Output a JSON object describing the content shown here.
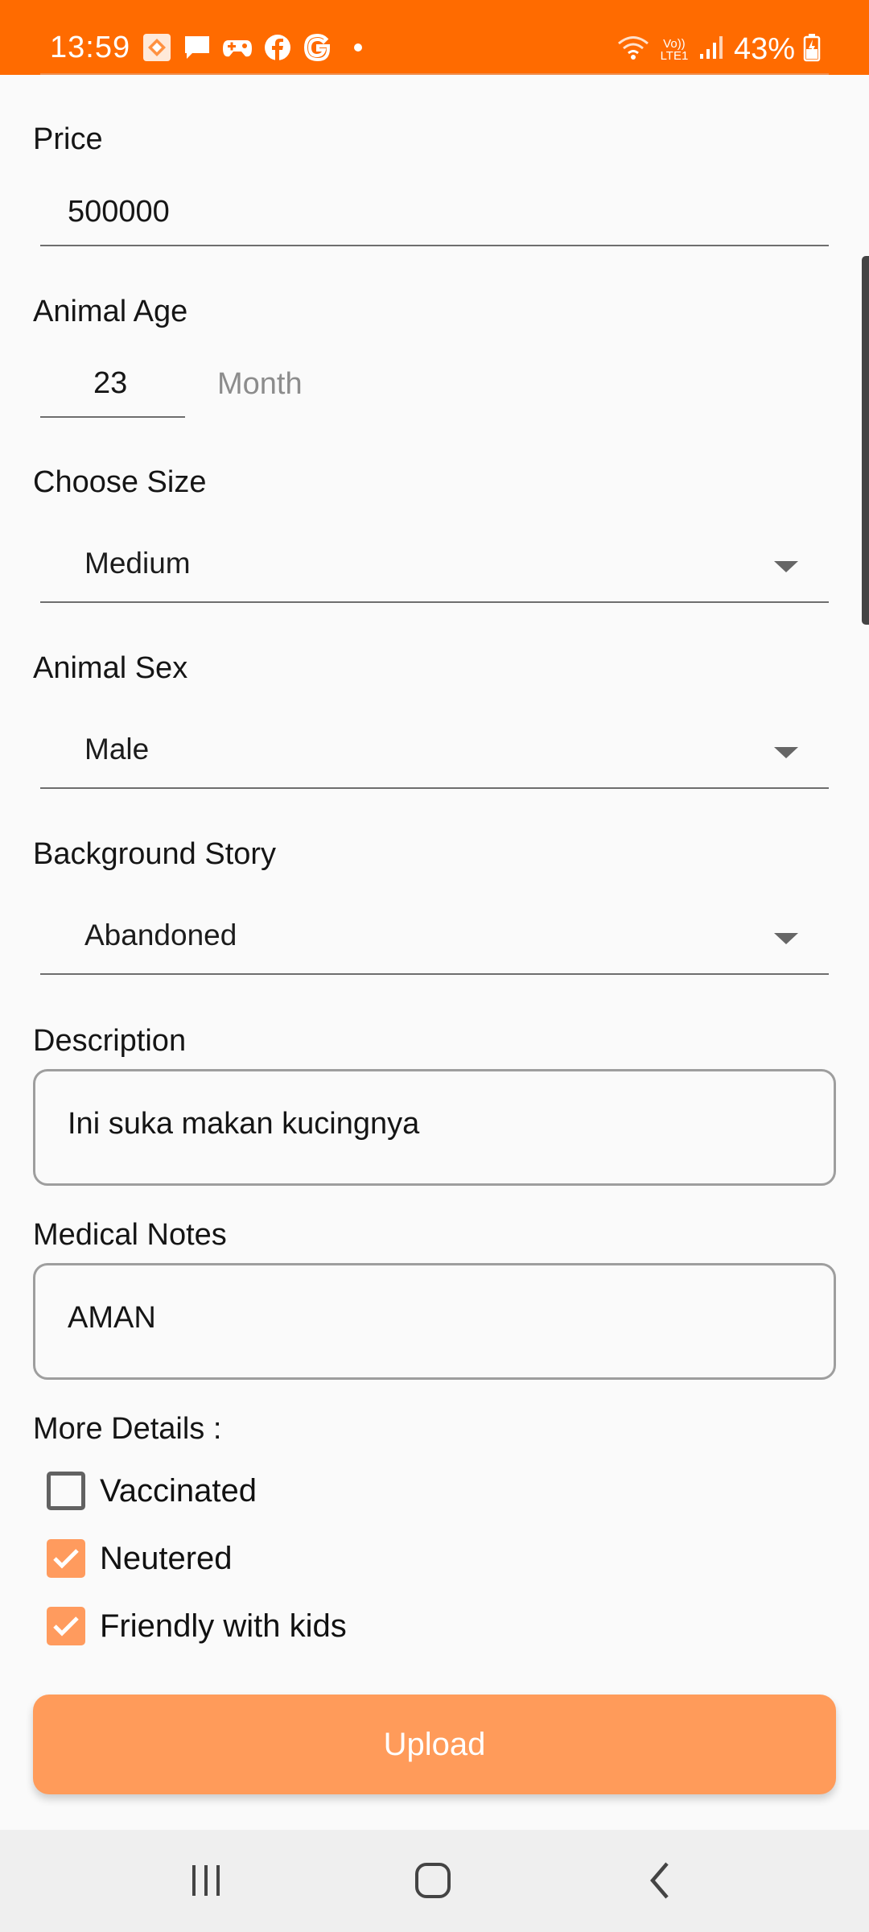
{
  "status_bar": {
    "time": "13:59",
    "battery_percent": "43%",
    "notification_icons": [
      "app-icon",
      "message-icon",
      "game-controller-icon",
      "facebook-icon",
      "google-icon",
      "dot-icon"
    ],
    "system_icons": [
      "wifi-icon",
      "volte-icon",
      "signal-icon",
      "battery-charging-icon"
    ],
    "volte_label": "Vo)) LTE1",
    "background_color": "#ff6b00"
  },
  "form": {
    "price": {
      "label": "Price",
      "value": "500000"
    },
    "animal_age": {
      "label": "Animal Age",
      "value": "23",
      "unit_hint": "Month"
    },
    "size": {
      "label": "Choose Size",
      "selected": "Medium"
    },
    "sex": {
      "label": "Animal Sex",
      "selected": "Male"
    },
    "background_story": {
      "label": "Background Story",
      "selected": "Abandoned"
    },
    "description": {
      "label": "Description",
      "value": "Ini suka makan kucingnya"
    },
    "medical_notes": {
      "label": "Medical Notes",
      "value": "AMAN"
    },
    "more_details": {
      "label": "More Details :",
      "options": [
        {
          "label": "Vaccinated",
          "checked": false
        },
        {
          "label": "Neutered",
          "checked": true
        },
        {
          "label": "Friendly with kids",
          "checked": true
        }
      ]
    },
    "upload_label": "Upload"
  },
  "colors": {
    "accent": "#ff6b00",
    "button": "#ff9b5a",
    "checkbox_checked": "#ff9b5e"
  },
  "nav_bar": {
    "buttons": [
      "recent-apps-icon",
      "home-icon",
      "back-icon"
    ]
  }
}
